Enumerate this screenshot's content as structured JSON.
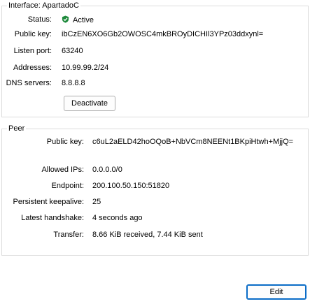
{
  "interface": {
    "legend": "Interface: ApartadoC",
    "fields": [
      {
        "label": "Status:",
        "value": "Active"
      },
      {
        "label": "Public key:",
        "value": "ibCzEN6XO6Gb2OWOSC4mkBROyDICHIl3YPz03ddxynl="
      },
      {
        "label": "Listen port:",
        "value": "63240"
      },
      {
        "label": "Addresses:",
        "value": "10.99.99.2/24"
      },
      {
        "label": "DNS servers:",
        "value": "8.8.8.8"
      }
    ],
    "status_icon": "shield-check-icon",
    "status_color": "#1e8a3c",
    "deactivate_label": "Deactivate"
  },
  "peer": {
    "legend": "Peer",
    "fields": [
      {
        "label": "Public key:",
        "value": "c6uL2aELD42hoOQoB+NbVCm8NEENt1BKpiHtwh+MjjQ="
      },
      {
        "label": "Allowed IPs:",
        "value": "0.0.0.0/0"
      },
      {
        "label": "Endpoint:",
        "value": "200.100.50.150:51820"
      },
      {
        "label": "Persistent keepalive:",
        "value": "25"
      },
      {
        "label": "Latest handshake:",
        "value": "4 seconds ago"
      },
      {
        "label": "Transfer:",
        "value": "8.66 KiB received, 7.44 KiB sent"
      }
    ]
  },
  "edit_label": "Edit"
}
